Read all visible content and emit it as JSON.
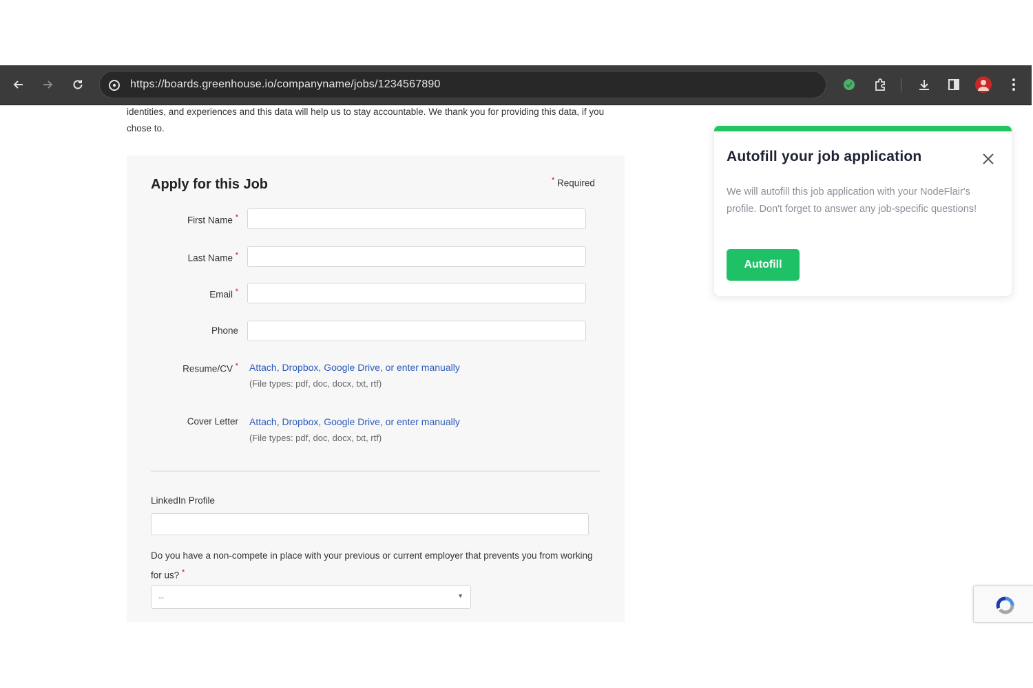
{
  "browser": {
    "url": "https://boards.greenhouse.io/companyname/jobs/1234567890",
    "icons": [
      "back-icon",
      "forward-icon",
      "reload-icon",
      "site-info-icon",
      "extension-nodeflair-icon",
      "extensions-puzzle-icon",
      "download-icon",
      "side-panel-icon",
      "profile-avatar",
      "menu-kebab-icon"
    ]
  },
  "page": {
    "intro": "identities, and experiences and this data will help us to stay accountable. We thank you for providing this data, if you chose to."
  },
  "form": {
    "title": "Apply for this Job",
    "required_star": "*",
    "required_note": "Required",
    "fields": {
      "first_name": "First Name",
      "last_name": "Last Name",
      "email": "Email",
      "phone": "Phone",
      "resume": "Resume/CV",
      "cover_letter": "Cover Letter"
    },
    "upload": {
      "attach": "Attach,",
      "dropbox": "Dropbox,",
      "google_drive": "Google Drive,",
      "or_enter": "or enter manually",
      "file_types": "(File types: pdf, doc, docx, txt, rtf)"
    },
    "linkedin_label": "LinkedIn Profile",
    "noncompete_question": "Do you have a non-compete in place with your previous or current employer that prevents you from working for us?",
    "noncompete_selected": "--"
  },
  "popup": {
    "title": "Autofill your job application",
    "body": "We will autofill this job application with your NodeFlair's profile. Don't forget to answer any job-specific questions!",
    "button": "Autofill",
    "accent_color": "#22c55e"
  },
  "colors": {
    "toolbar": "#3b3b3b",
    "link": "#2d5bb8",
    "required": "#d0021b",
    "button": "#1fc167"
  }
}
